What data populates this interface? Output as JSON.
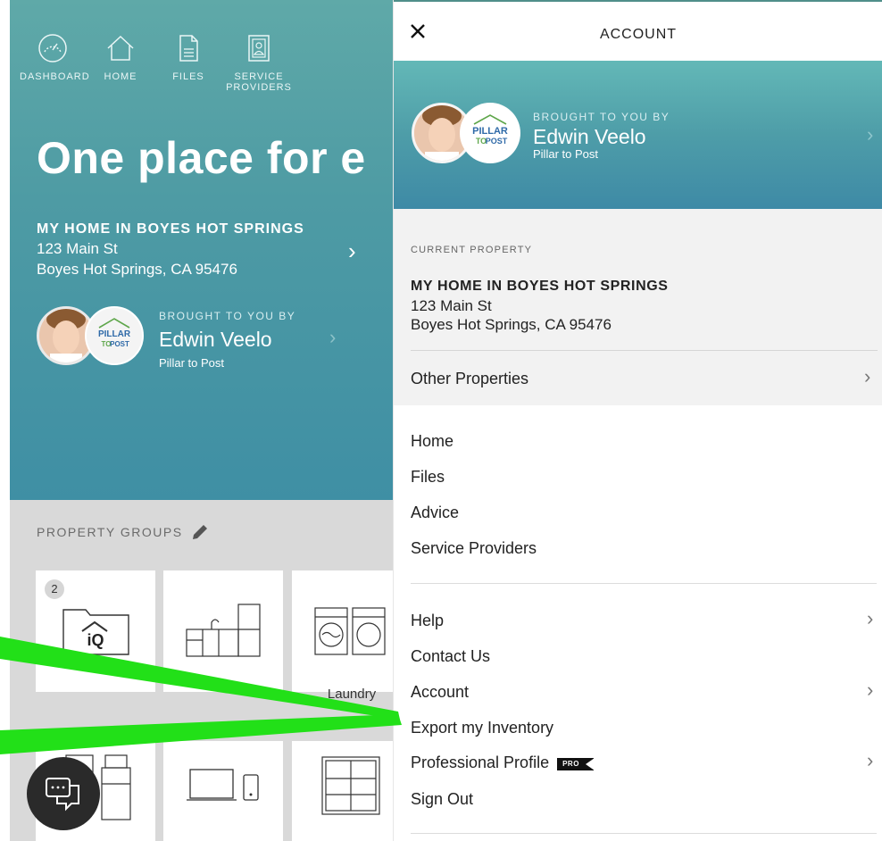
{
  "background": {
    "nav": [
      {
        "label": "DASHBOARD",
        "icon": "dashboard-gauge-icon"
      },
      {
        "label": "HOME",
        "icon": "home-icon"
      },
      {
        "label": "FILES",
        "icon": "file-icon"
      },
      {
        "label": "SERVICE PROVIDERS",
        "icon": "service-providers-icon"
      }
    ],
    "hero_title": "One place for e",
    "property": {
      "name": "MY HOME IN BOYES HOT SPRINGS",
      "street": "123 Main St",
      "city": "Boyes Hot Springs, CA 95476"
    },
    "brought": {
      "label": "BROUGHT TO YOU BY",
      "name": "Edwin Veelo",
      "company": "Pillar to Post"
    },
    "property_groups_label": "PROPERTY GROUPS",
    "cards": [
      {
        "badge": "2",
        "icon": "home-iq-folder-icon",
        "label": ""
      },
      {
        "icon": "kitchen-icon",
        "label": ""
      },
      {
        "icon": "laundry-icon",
        "label": "Laundry"
      },
      {
        "icon": "appliances-icon",
        "label": ""
      },
      {
        "icon": "electronics-icon",
        "label": ""
      },
      {
        "icon": "windows-icon",
        "label": ""
      }
    ],
    "logo_text": {
      "line1": "PILLAR",
      "line2_a": "TO",
      "line2_b": "POST"
    }
  },
  "drawer": {
    "title": "ACCOUNT",
    "brought_label": "BROUGHT TO YOU BY",
    "agent_name": "Edwin Veelo",
    "agent_company": "Pillar to Post",
    "current_label": "CURRENT PROPERTY",
    "property_name": "MY HOME IN BOYES HOT SPRINGS",
    "property_street": "123 Main St",
    "property_city": "Boyes Hot Springs, CA 95476",
    "other_properties": "Other Properties",
    "nav_items": [
      "Home",
      "Files",
      "Advice",
      "Service Providers"
    ],
    "support_items": [
      {
        "label": "Help",
        "chevron": true
      },
      {
        "label": "Contact Us",
        "chevron": false
      },
      {
        "label": "Account",
        "chevron": true
      },
      {
        "label": "Export my Inventory",
        "chevron": false
      },
      {
        "label": "Professional Profile",
        "chevron": true,
        "badge": "PRO"
      },
      {
        "label": "Sign Out",
        "chevron": false
      }
    ]
  },
  "colors": {
    "hero_top": "#5fa9a8",
    "hero_bottom": "#3f8fa4",
    "annotation_line": "#22e018",
    "logo_green": "#5ea64a",
    "logo_blue": "#2f6aa8"
  }
}
